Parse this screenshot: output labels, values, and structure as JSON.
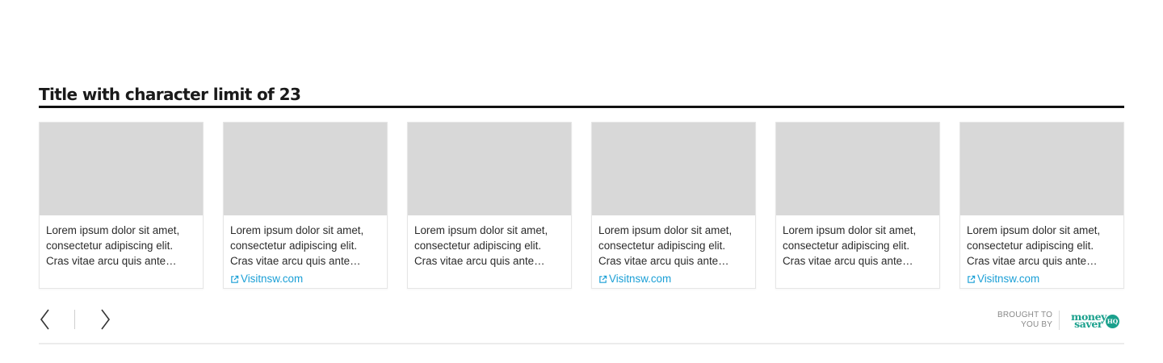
{
  "widget": {
    "title": "Title with character limit of 23"
  },
  "cards": [
    {
      "text": "Lorem ipsum dolor sit amet, consectetur adipiscing elit. Cras vitae arcu quis ante…",
      "link": ""
    },
    {
      "text": "Lorem ipsum dolor sit amet, consectetur adipiscing elit. Cras vitae arcu quis ante…",
      "link": "Visitnsw.com"
    },
    {
      "text": "Lorem ipsum dolor sit amet, consectetur adipiscing elit. Cras vitae arcu quis ante…",
      "link": ""
    },
    {
      "text": "Lorem ipsum dolor sit amet, consectetur adipiscing elit. Cras vitae arcu quis ante…",
      "link": "Visitnsw.com"
    },
    {
      "text": "Lorem ipsum dolor sit amet, consectetur adipiscing elit. Cras vitae arcu quis ante…",
      "link": ""
    },
    {
      "text": "Lorem ipsum dolor sit amet, consectetur adipiscing elit. Cras vitae arcu quis ante…",
      "link": "Visitnsw.com"
    }
  ],
  "nav": {
    "prev_icon": "chevron-left-icon",
    "next_icon": "chevron-right-icon"
  },
  "sponsor": {
    "label_line1": "BROUGHT TO",
    "label_line2": "YOU BY",
    "logo_line1": "money",
    "logo_line2": "saver",
    "logo_badge": "HQ"
  },
  "colors": {
    "title": "#1a1a1a",
    "rule": "#111111",
    "image_placeholder": "#d8d8d8",
    "link": "#1a9fd6",
    "brand": "#1aa08c"
  }
}
